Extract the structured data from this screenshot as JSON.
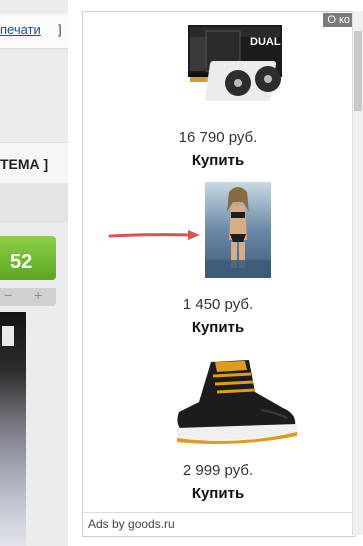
{
  "left": {
    "print_link": "печати",
    "print_bracket": "]",
    "tema_label": "ТЕМА ]",
    "vote_count": "52",
    "vote_minus": "−",
    "vote_plus": "+"
  },
  "ad": {
    "badge": "О ко",
    "footer": "Ads by goods.ru",
    "products": [
      {
        "price": "16 790 руб.",
        "buy": "Купить",
        "image": "graphics-card-image",
        "brand_text": "DUAL"
      },
      {
        "price": "1 450 руб.",
        "buy": "Купить",
        "image": "swimsuit-model-image"
      },
      {
        "price": "2 999 руб.",
        "buy": "Купить",
        "image": "boot-image"
      }
    ]
  },
  "colors": {
    "vote_green": "#6fba2c",
    "arrow_red": "#d9534f",
    "link_blue": "#1a4f9c"
  }
}
